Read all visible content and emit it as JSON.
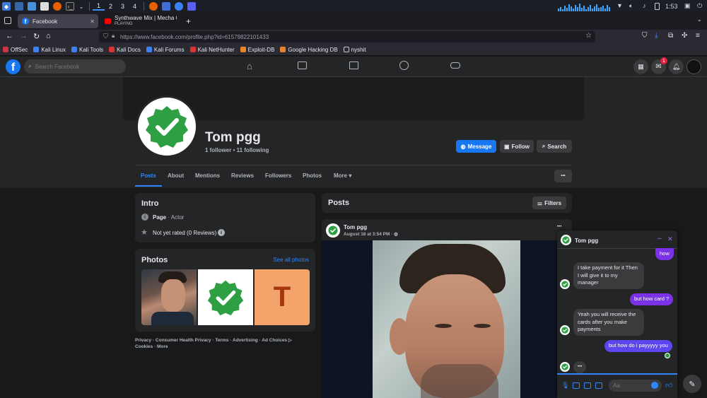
{
  "panel": {
    "workspaces": [
      "1",
      "2",
      "3",
      "4"
    ],
    "volume": "",
    "time": "1:53"
  },
  "browser": {
    "tabs": [
      {
        "title": "Facebook",
        "subtitle": ""
      },
      {
        "title": "Synthwave Mix | Mecha C",
        "subtitle": "PLAYING"
      }
    ],
    "url": "https://www.facebook.com/profile.php?id=61579822101433",
    "bookmarks": [
      "OffSec",
      "Kali Linux",
      "Kali Tools",
      "Kali Docs",
      "Kali Forums",
      "Kali NetHunter",
      "Exploit-DB",
      "Google Hacking DB",
      "nyshit"
    ]
  },
  "fb": {
    "search_placeholder": "Search Facebook",
    "notif_count": "1"
  },
  "profile": {
    "name": "Tom pgg",
    "stats": "1 follower • 11 following",
    "message_label": "Message",
    "follow_label": "Follow",
    "search_label": "Search",
    "tabs": [
      "Posts",
      "About",
      "Mentions",
      "Reviews",
      "Followers",
      "Photos",
      "More"
    ],
    "more_dots": "•••"
  },
  "intro": {
    "title": "Intro",
    "page_label": "Page",
    "page_type": " · Actor",
    "rating": "Not yet rated (0 Reviews)"
  },
  "photos": {
    "title": "Photos",
    "see_all": "See all photos",
    "tile_letter": "T"
  },
  "footer": {
    "links": "Privacy · Consumer Health Privacy · Terms · Advertising · Ad Choices",
    "links2": "Cookies · More"
  },
  "posts": {
    "header": "Posts",
    "filters_label": "Filters",
    "author": "Tom pgg",
    "date": "August 18 at 3:54 PM · ",
    "menu_dots": "•••"
  },
  "chat": {
    "name": "Tom pgg",
    "messages": [
      {
        "dir": "out",
        "text": "how"
      },
      {
        "dir": "in",
        "text": "I take payment for it Then I will give it to my manager"
      },
      {
        "dir": "out",
        "text": "but how card ?"
      },
      {
        "dir": "in",
        "text": "Yeah you will receive the cards after you make payments"
      },
      {
        "dir": "out",
        "text": "but how do i payyyyy you"
      },
      {
        "dir": "in",
        "text": "•••"
      }
    ],
    "input_placeholder": "Aa"
  },
  "colors": {
    "fb_blue": "#1877f2",
    "chat_purple": "#7b32e6",
    "link_blue": "#2d88ff",
    "verified_green": "#2ea043",
    "tile_orange": "#f4a46a",
    "tile_letter": "#a4370e"
  }
}
